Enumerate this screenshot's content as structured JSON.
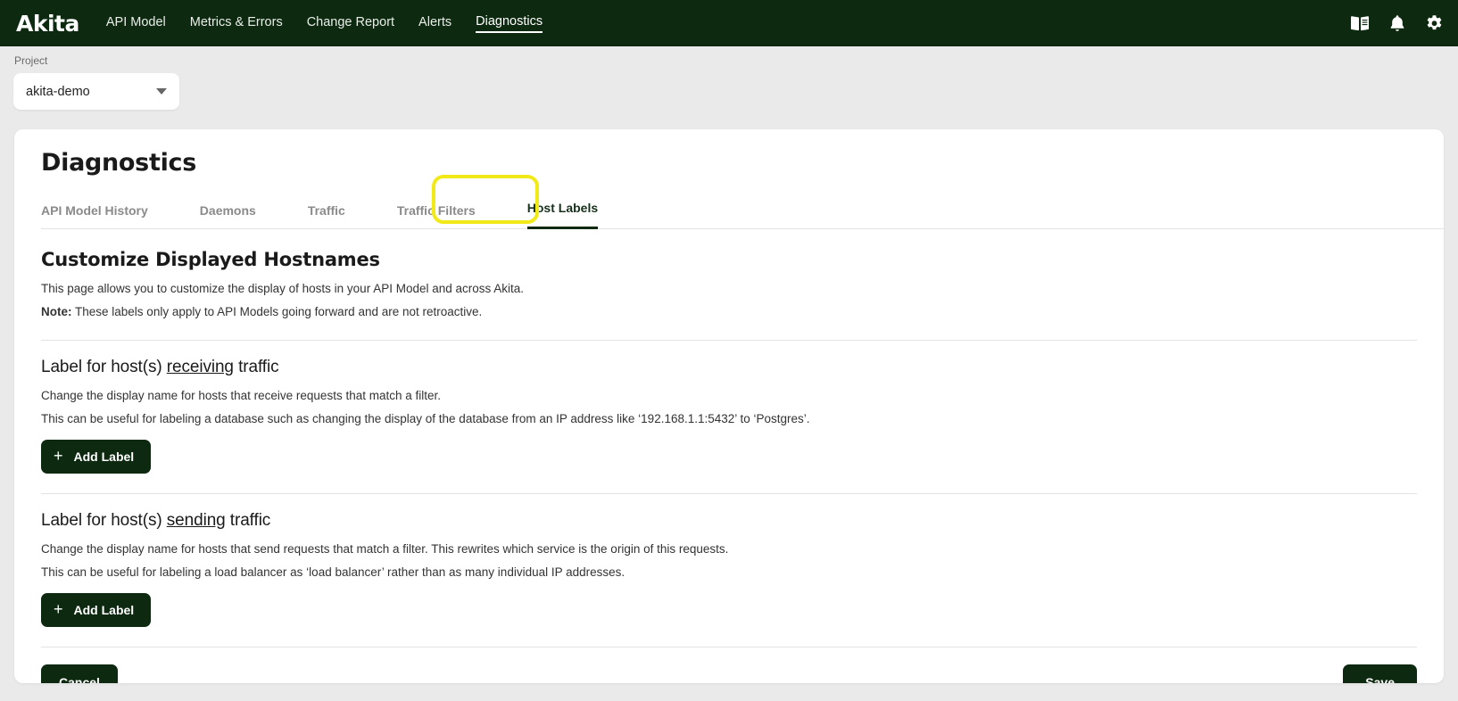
{
  "topnav": {
    "logo": "Akita",
    "links": [
      {
        "label": "API Model",
        "active": false
      },
      {
        "label": "Metrics & Errors",
        "active": false
      },
      {
        "label": "Change Report",
        "active": false
      },
      {
        "label": "Alerts",
        "active": false
      },
      {
        "label": "Diagnostics",
        "active": true
      }
    ],
    "icons": [
      "book-icon",
      "bell-icon",
      "gear-icon"
    ],
    "background_color": "#0d2a11"
  },
  "project_bar": {
    "label": "Project",
    "selected": "akita-demo",
    "dropdown_icon": "chevron-down-icon"
  },
  "page": {
    "title": "Diagnostics",
    "tabs": [
      {
        "label": "API Model History",
        "active": false
      },
      {
        "label": "Daemons",
        "active": false
      },
      {
        "label": "Traffic",
        "active": false
      },
      {
        "label": "Traffic Filters",
        "active": false
      },
      {
        "label": "Host Labels",
        "active": true
      }
    ],
    "highlight_color": "#f2ea18"
  },
  "main": {
    "heading": "Customize Displayed Hostnames",
    "intro_1": "This page allows you to customize the display of hosts in your API Model and across Akita.",
    "note_label": "Note:",
    "note_text": "These labels only apply to API Models going forward and are not retroactive."
  },
  "receiving": {
    "heading_pre": "Label for host(s) ",
    "heading_underlined": "receiving",
    "heading_post": " traffic",
    "desc_1": "Change the display name for hosts that receive requests that match a filter.",
    "desc_2": "This can be useful for labeling a database such as changing the display of the database from an IP address like ‘192.168.1.1:5432’ to ‘Postgres’.",
    "add_button": "Add Label",
    "add_icon": "plus-icon"
  },
  "sending": {
    "heading_pre": "Label for host(s) ",
    "heading_underlined": "sending",
    "heading_post": " traffic",
    "desc_1": "Change the display name for hosts that send requests that match a filter. This rewrites which service is the origin of this requests.",
    "desc_2": "This can be useful for labeling a load balancer as ‘load balancer’ rather than as many individual IP addresses.",
    "add_button": "Add Label",
    "add_icon": "plus-icon"
  },
  "footer": {
    "cancel": "Cancel",
    "save": "Save"
  }
}
